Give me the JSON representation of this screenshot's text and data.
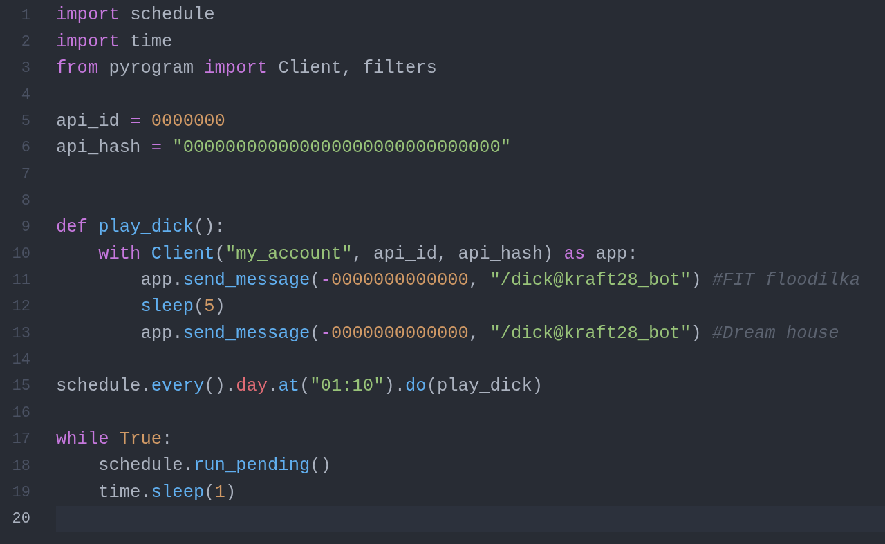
{
  "editor": {
    "lines": [
      {
        "number": "1",
        "current": false,
        "tokens": [
          {
            "kind": "keyword",
            "text": "import"
          },
          {
            "kind": "plain",
            "text": " schedule"
          }
        ]
      },
      {
        "number": "2",
        "current": false,
        "tokens": [
          {
            "kind": "keyword",
            "text": "import"
          },
          {
            "kind": "plain",
            "text": " time"
          }
        ]
      },
      {
        "number": "3",
        "current": false,
        "tokens": [
          {
            "kind": "keyword",
            "text": "from"
          },
          {
            "kind": "plain",
            "text": " pyrogram "
          },
          {
            "kind": "keyword",
            "text": "import"
          },
          {
            "kind": "plain",
            "text": " Client, filters"
          }
        ]
      },
      {
        "number": "4",
        "current": false
      },
      {
        "number": "5",
        "current": false,
        "tokens": [
          {
            "kind": "plain",
            "text": "api_id "
          },
          {
            "kind": "operator",
            "text": "= "
          },
          {
            "kind": "number",
            "text": "0000000"
          }
        ]
      },
      {
        "number": "6",
        "current": false,
        "tokens": [
          {
            "kind": "plain",
            "text": "api_hash "
          },
          {
            "kind": "operator",
            "text": "= "
          },
          {
            "kind": "string",
            "text": "\"000000000000000000000000000000\""
          }
        ]
      },
      {
        "number": "7",
        "current": false
      },
      {
        "number": "8",
        "current": false
      },
      {
        "number": "9",
        "current": false,
        "tokens": [
          {
            "kind": "keyword",
            "text": "def "
          },
          {
            "kind": "function",
            "text": "play_dick"
          },
          {
            "kind": "plain",
            "text": "():"
          }
        ]
      },
      {
        "number": "10",
        "current": false,
        "tokens": [
          {
            "kind": "keyword",
            "text": "    with "
          },
          {
            "kind": "function",
            "text": "Client"
          },
          {
            "kind": "plain",
            "text": "("
          },
          {
            "kind": "string",
            "text": "\"my_account\""
          },
          {
            "kind": "plain",
            "text": ", api_id, api_hash) "
          },
          {
            "kind": "keyword",
            "text": "as"
          },
          {
            "kind": "plain",
            "text": " app:"
          }
        ]
      },
      {
        "number": "11",
        "current": false,
        "tokens": [
          {
            "kind": "plain",
            "text": "        app."
          },
          {
            "kind": "function",
            "text": "send_message"
          },
          {
            "kind": "plain",
            "text": "("
          },
          {
            "kind": "operator",
            "text": "-"
          },
          {
            "kind": "number",
            "text": "0000000000000"
          },
          {
            "kind": "plain",
            "text": ", "
          },
          {
            "kind": "string",
            "text": "\"/dick@kraft28_bot\""
          },
          {
            "kind": "plain",
            "text": ") "
          },
          {
            "kind": "comment",
            "text": "#FIT floodilka"
          }
        ]
      },
      {
        "number": "12",
        "current": false,
        "tokens": [
          {
            "kind": "function",
            "text": "        sleep"
          },
          {
            "kind": "plain",
            "text": "("
          },
          {
            "kind": "number",
            "text": "5"
          },
          {
            "kind": "plain",
            "text": ")"
          }
        ]
      },
      {
        "number": "13",
        "current": false,
        "tokens": [
          {
            "kind": "plain",
            "text": "        app."
          },
          {
            "kind": "function",
            "text": "send_message"
          },
          {
            "kind": "plain",
            "text": "("
          },
          {
            "kind": "operator",
            "text": "-"
          },
          {
            "kind": "number",
            "text": "0000000000000"
          },
          {
            "kind": "plain",
            "text": ", "
          },
          {
            "kind": "string",
            "text": "\"/dick@kraft28_bot\""
          },
          {
            "kind": "plain",
            "text": ") "
          },
          {
            "kind": "comment",
            "text": "#Dream house"
          }
        ]
      },
      {
        "number": "14",
        "current": false
      },
      {
        "number": "15",
        "current": false,
        "tokens": [
          {
            "kind": "plain",
            "text": "schedule."
          },
          {
            "kind": "function",
            "text": "every"
          },
          {
            "kind": "plain",
            "text": "()."
          },
          {
            "kind": "property",
            "text": "day"
          },
          {
            "kind": "plain",
            "text": "."
          },
          {
            "kind": "function",
            "text": "at"
          },
          {
            "kind": "plain",
            "text": "("
          },
          {
            "kind": "string",
            "text": "\"01:10\""
          },
          {
            "kind": "plain",
            "text": ")."
          },
          {
            "kind": "function",
            "text": "do"
          },
          {
            "kind": "plain",
            "text": "(play_dick)"
          }
        ]
      },
      {
        "number": "16",
        "current": false
      },
      {
        "number": "17",
        "current": false,
        "tokens": [
          {
            "kind": "keyword",
            "text": "while "
          },
          {
            "kind": "number",
            "text": "True"
          },
          {
            "kind": "plain",
            "text": ":"
          }
        ]
      },
      {
        "number": "18",
        "current": false,
        "tokens": [
          {
            "kind": "plain",
            "text": "    schedule."
          },
          {
            "kind": "function",
            "text": "run_pending"
          },
          {
            "kind": "plain",
            "text": "()"
          }
        ]
      },
      {
        "number": "19",
        "current": false,
        "tokens": [
          {
            "kind": "plain",
            "text": "    time."
          },
          {
            "kind": "function",
            "text": "sleep"
          },
          {
            "kind": "plain",
            "text": "("
          },
          {
            "kind": "number",
            "text": "1"
          },
          {
            "kind": "plain",
            "text": ")"
          }
        ]
      },
      {
        "number": "20",
        "current": true
      }
    ]
  }
}
